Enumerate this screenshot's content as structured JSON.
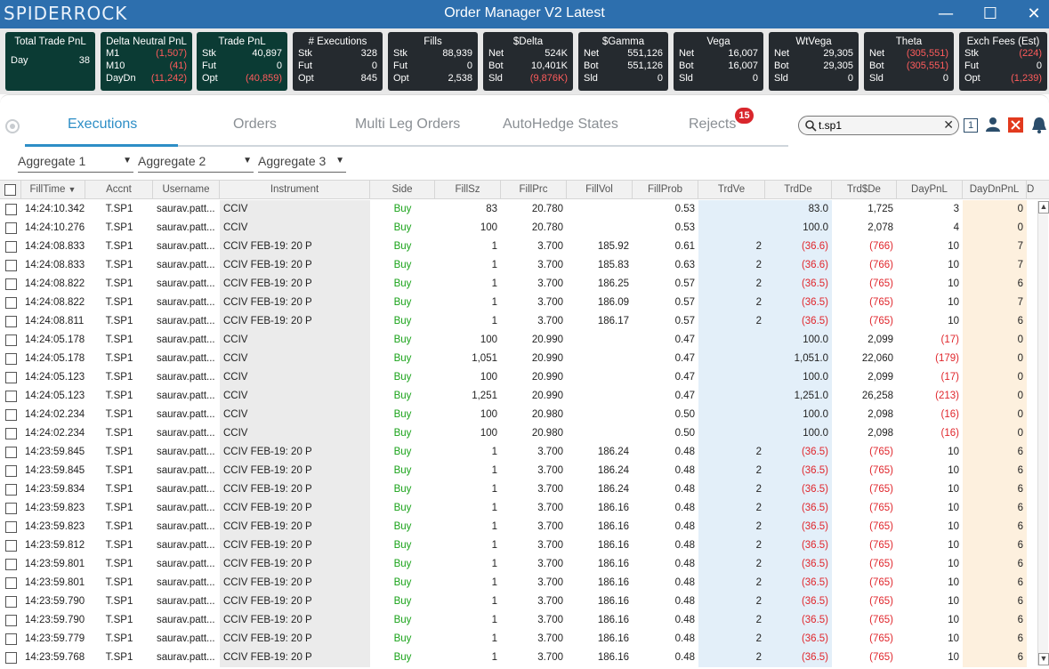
{
  "window": {
    "brand": "SPIDERROCK",
    "title": "Order Manager V2 Latest",
    "minimize": "—",
    "maximize": "☐",
    "close": "✕"
  },
  "stats": {
    "total_trade_pnl": {
      "title": "Total Trade PnL",
      "label": "Day",
      "value": "38"
    },
    "delta_neutral": {
      "title": "Delta Neutral PnL",
      "rows": [
        [
          "M1",
          "(1,507)"
        ],
        [
          "M10",
          "(41)"
        ],
        [
          "DayDn",
          "(11,242)"
        ]
      ]
    },
    "trade_pnl": {
      "title": "Trade PnL",
      "rows": [
        [
          "Stk",
          "40,897"
        ],
        [
          "Fut",
          "0"
        ],
        [
          "Opt",
          "(40,859)"
        ]
      ]
    },
    "executions": {
      "title": "# Executions",
      "rows": [
        [
          "Stk",
          "328"
        ],
        [
          "Fut",
          "0"
        ],
        [
          "Opt",
          "845"
        ]
      ]
    },
    "fills": {
      "title": "Fills",
      "rows": [
        [
          "Stk",
          "88,939"
        ],
        [
          "Fut",
          "0"
        ],
        [
          "Opt",
          "2,538"
        ]
      ]
    },
    "sdelta": {
      "title": "$Delta",
      "rows": [
        [
          "Net",
          "524K"
        ],
        [
          "Bot",
          "10,401K"
        ],
        [
          "Sld",
          "(9,876K)"
        ]
      ]
    },
    "sgamma": {
      "title": "$Gamma",
      "rows": [
        [
          "Net",
          "551,126"
        ],
        [
          "Bot",
          "551,126"
        ],
        [
          "Sld",
          "0"
        ]
      ]
    },
    "vega": {
      "title": "Vega",
      "rows": [
        [
          "Net",
          "16,007"
        ],
        [
          "Bot",
          "16,007"
        ],
        [
          "Sld",
          "0"
        ]
      ]
    },
    "wtvega": {
      "title": "WtVega",
      "rows": [
        [
          "Net",
          "29,305"
        ],
        [
          "Bot",
          "29,305"
        ],
        [
          "Sld",
          "0"
        ]
      ]
    },
    "theta": {
      "title": "Theta",
      "rows": [
        [
          "Net",
          "(305,551)"
        ],
        [
          "Bot",
          "(305,551)"
        ],
        [
          "Sld",
          "0"
        ]
      ]
    },
    "exch_fees": {
      "title": "Exch Fees (Est)",
      "rows": [
        [
          "Stk",
          "(224)"
        ],
        [
          "Fut",
          "0"
        ],
        [
          "Opt",
          "(1,239)"
        ]
      ]
    }
  },
  "tabs": {
    "executions": "Executions",
    "orders": "Orders",
    "multi_leg": "Multi Leg Orders",
    "autohedge": "AutoHedge States",
    "rejects": "Rejects",
    "rejects_count": "15"
  },
  "search": {
    "value": "t.sp1",
    "icon": "search-icon",
    "clear": "✕"
  },
  "toolbar": {
    "one_label": "1"
  },
  "aggregates": [
    "Aggregate 1",
    "Aggregate 2",
    "Aggregate 3"
  ],
  "columns": [
    "FillTime",
    "Accnt",
    "Username",
    "Instrument",
    "Side",
    "FillSz",
    "FillPrc",
    "FillVol",
    "FillProb",
    "TrdVe",
    "TrdDe",
    "Trd$De",
    "DayPnL",
    "DayDnPnL",
    "D"
  ],
  "rows": [
    [
      "14:24:10.342",
      "T.SP1",
      "saurav.patt...",
      "CCIV",
      "Buy",
      "83",
      "20.780",
      "",
      "0.53",
      "",
      "83.0",
      "1,725",
      "3",
      "0"
    ],
    [
      "14:24:10.276",
      "T.SP1",
      "saurav.patt...",
      "CCIV",
      "Buy",
      "100",
      "20.780",
      "",
      "0.53",
      "",
      "100.0",
      "2,078",
      "4",
      "0"
    ],
    [
      "14:24:08.833",
      "T.SP1",
      "saurav.patt...",
      "CCIV FEB-19: 20 P",
      "Buy",
      "1",
      "3.700",
      "185.92",
      "0.61",
      "2",
      "(36.6)",
      "(766)",
      "10",
      "7"
    ],
    [
      "14:24:08.833",
      "T.SP1",
      "saurav.patt...",
      "CCIV FEB-19: 20 P",
      "Buy",
      "1",
      "3.700",
      "185.83",
      "0.63",
      "2",
      "(36.6)",
      "(766)",
      "10",
      "7"
    ],
    [
      "14:24:08.822",
      "T.SP1",
      "saurav.patt...",
      "CCIV FEB-19: 20 P",
      "Buy",
      "1",
      "3.700",
      "186.25",
      "0.57",
      "2",
      "(36.5)",
      "(765)",
      "10",
      "6"
    ],
    [
      "14:24:08.822",
      "T.SP1",
      "saurav.patt...",
      "CCIV FEB-19: 20 P",
      "Buy",
      "1",
      "3.700",
      "186.09",
      "0.57",
      "2",
      "(36.5)",
      "(765)",
      "10",
      "7"
    ],
    [
      "14:24:08.811",
      "T.SP1",
      "saurav.patt...",
      "CCIV FEB-19: 20 P",
      "Buy",
      "1",
      "3.700",
      "186.17",
      "0.57",
      "2",
      "(36.5)",
      "(765)",
      "10",
      "6"
    ],
    [
      "14:24:05.178",
      "T.SP1",
      "saurav.patt...",
      "CCIV",
      "Buy",
      "100",
      "20.990",
      "",
      "0.47",
      "",
      "100.0",
      "2,099",
      "(17)",
      "0"
    ],
    [
      "14:24:05.178",
      "T.SP1",
      "saurav.patt...",
      "CCIV",
      "Buy",
      "1,051",
      "20.990",
      "",
      "0.47",
      "",
      "1,051.0",
      "22,060",
      "(179)",
      "0"
    ],
    [
      "14:24:05.123",
      "T.SP1",
      "saurav.patt...",
      "CCIV",
      "Buy",
      "100",
      "20.990",
      "",
      "0.47",
      "",
      "100.0",
      "2,099",
      "(17)",
      "0"
    ],
    [
      "14:24:05.123",
      "T.SP1",
      "saurav.patt...",
      "CCIV",
      "Buy",
      "1,251",
      "20.990",
      "",
      "0.47",
      "",
      "1,251.0",
      "26,258",
      "(213)",
      "0"
    ],
    [
      "14:24:02.234",
      "T.SP1",
      "saurav.patt...",
      "CCIV",
      "Buy",
      "100",
      "20.980",
      "",
      "0.50",
      "",
      "100.0",
      "2,098",
      "(16)",
      "0"
    ],
    [
      "14:24:02.234",
      "T.SP1",
      "saurav.patt...",
      "CCIV",
      "Buy",
      "100",
      "20.980",
      "",
      "0.50",
      "",
      "100.0",
      "2,098",
      "(16)",
      "0"
    ],
    [
      "14:23:59.845",
      "T.SP1",
      "saurav.patt...",
      "CCIV FEB-19: 20 P",
      "Buy",
      "1",
      "3.700",
      "186.24",
      "0.48",
      "2",
      "(36.5)",
      "(765)",
      "10",
      "6"
    ],
    [
      "14:23:59.845",
      "T.SP1",
      "saurav.patt...",
      "CCIV FEB-19: 20 P",
      "Buy",
      "1",
      "3.700",
      "186.24",
      "0.48",
      "2",
      "(36.5)",
      "(765)",
      "10",
      "6"
    ],
    [
      "14:23:59.834",
      "T.SP1",
      "saurav.patt...",
      "CCIV FEB-19: 20 P",
      "Buy",
      "1",
      "3.700",
      "186.24",
      "0.48",
      "2",
      "(36.5)",
      "(765)",
      "10",
      "6"
    ],
    [
      "14:23:59.823",
      "T.SP1",
      "saurav.patt...",
      "CCIV FEB-19: 20 P",
      "Buy",
      "1",
      "3.700",
      "186.16",
      "0.48",
      "2",
      "(36.5)",
      "(765)",
      "10",
      "6"
    ],
    [
      "14:23:59.823",
      "T.SP1",
      "saurav.patt...",
      "CCIV FEB-19: 20 P",
      "Buy",
      "1",
      "3.700",
      "186.16",
      "0.48",
      "2",
      "(36.5)",
      "(765)",
      "10",
      "6"
    ],
    [
      "14:23:59.812",
      "T.SP1",
      "saurav.patt...",
      "CCIV FEB-19: 20 P",
      "Buy",
      "1",
      "3.700",
      "186.16",
      "0.48",
      "2",
      "(36.5)",
      "(765)",
      "10",
      "6"
    ],
    [
      "14:23:59.801",
      "T.SP1",
      "saurav.patt...",
      "CCIV FEB-19: 20 P",
      "Buy",
      "1",
      "3.700",
      "186.16",
      "0.48",
      "2",
      "(36.5)",
      "(765)",
      "10",
      "6"
    ],
    [
      "14:23:59.801",
      "T.SP1",
      "saurav.patt...",
      "CCIV FEB-19: 20 P",
      "Buy",
      "1",
      "3.700",
      "186.16",
      "0.48",
      "2",
      "(36.5)",
      "(765)",
      "10",
      "6"
    ],
    [
      "14:23:59.790",
      "T.SP1",
      "saurav.patt...",
      "CCIV FEB-19: 20 P",
      "Buy",
      "1",
      "3.700",
      "186.16",
      "0.48",
      "2",
      "(36.5)",
      "(765)",
      "10",
      "6"
    ],
    [
      "14:23:59.790",
      "T.SP1",
      "saurav.patt...",
      "CCIV FEB-19: 20 P",
      "Buy",
      "1",
      "3.700",
      "186.16",
      "0.48",
      "2",
      "(36.5)",
      "(765)",
      "10",
      "6"
    ],
    [
      "14:23:59.779",
      "T.SP1",
      "saurav.patt...",
      "CCIV FEB-19: 20 P",
      "Buy",
      "1",
      "3.700",
      "186.16",
      "0.48",
      "2",
      "(36.5)",
      "(765)",
      "10",
      "6"
    ],
    [
      "14:23:59.768",
      "T.SP1",
      "saurav.patt...",
      "CCIV FEB-19: 20 P",
      "Buy",
      "1",
      "3.700",
      "186.16",
      "0.48",
      "2",
      "(36.5)",
      "(765)",
      "10",
      "6"
    ]
  ],
  "colors": {
    "titlebar": "#2d6fae",
    "accent": "#2d8ec6",
    "buy": "#1aa31a",
    "negative": "#e0262c"
  }
}
